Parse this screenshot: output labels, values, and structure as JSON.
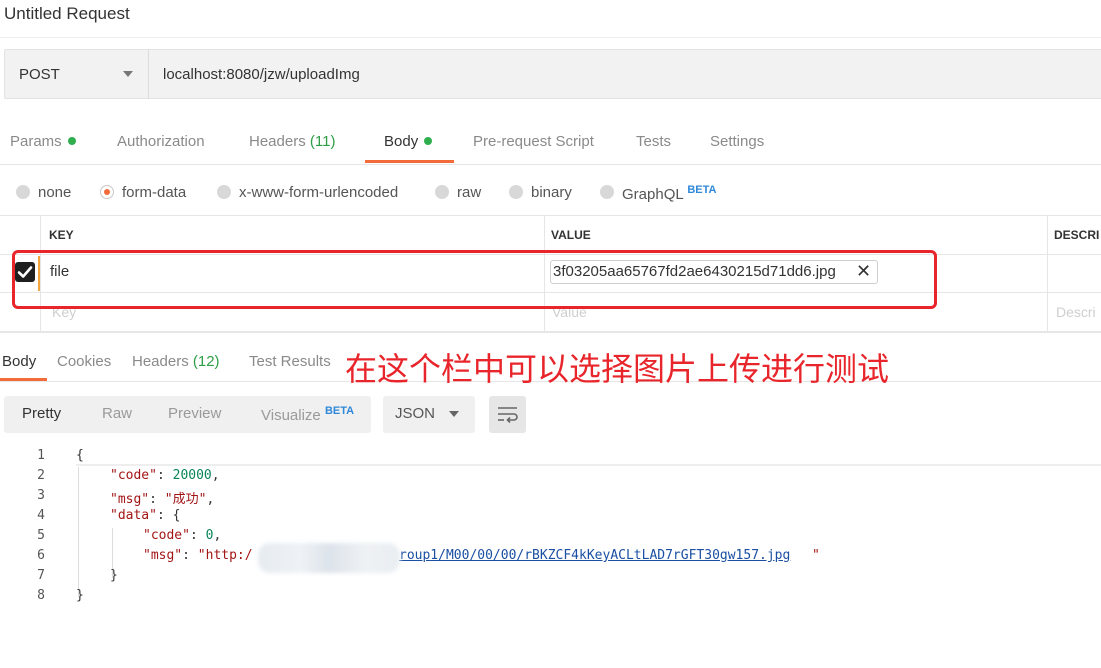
{
  "window": {
    "title": "Untitled Request"
  },
  "request": {
    "method": "POST",
    "url": "localhost:8080/jzw/uploadImg"
  },
  "request_tabs": [
    {
      "label": "Params",
      "indicator": "dot"
    },
    {
      "label": "Authorization"
    },
    {
      "label": "Headers",
      "count": "(11)"
    },
    {
      "label": "Body",
      "indicator": "dot",
      "active": true
    },
    {
      "label": "Pre-request Script"
    },
    {
      "label": "Tests"
    },
    {
      "label": "Settings"
    }
  ],
  "body_types": [
    {
      "label": "none",
      "selected": false
    },
    {
      "label": "form-data",
      "selected": true
    },
    {
      "label": "x-www-form-urlencoded",
      "selected": false
    },
    {
      "label": "raw",
      "selected": false
    },
    {
      "label": "binary",
      "selected": false
    },
    {
      "label": "GraphQL",
      "badge": "BETA",
      "selected": false
    }
  ],
  "form_table": {
    "headers": [
      "KEY",
      "VALUE",
      "DESCRI"
    ],
    "rows": [
      {
        "checked": true,
        "key": "file",
        "value": "3f03205aa65767fd2ae6430215d71dd6.jpg"
      }
    ],
    "placeholders": {
      "key": "Key",
      "value": "Value",
      "description": "Descri"
    }
  },
  "response_tabs": [
    {
      "label": "Body",
      "active": true
    },
    {
      "label": "Cookies"
    },
    {
      "label": "Headers",
      "count": "(12)"
    },
    {
      "label": "Test Results"
    }
  ],
  "annotation": "在这个栏中可以选择图片上传进行测试",
  "format_toolbar": {
    "modes": [
      "Pretty",
      "Raw",
      "Preview",
      "Visualize"
    ],
    "visualize_badge": "BETA",
    "language": "JSON"
  },
  "response_code": {
    "line_numbers": [
      "1",
      "2",
      "3",
      "4",
      "5",
      "6",
      "7",
      "8"
    ],
    "lines": {
      "l1": "{",
      "l2_key": "\"code\"",
      "l2_val": "20000",
      "l3_key": "\"msg\"",
      "l3_val": "\"成功\"",
      "l4_key": "\"data\"",
      "l4_open": "{",
      "l5_key": "\"code\"",
      "l5_val": "0",
      "l6_key": "\"msg\"",
      "l6_val_start": "\"http:/",
      "l6_val_end": "roup1/M00/00/00/rBKZCF4kKeyACLtLAD7rGFT30gw157.jpg",
      "l6_quote": "\"",
      "l7": "}",
      "l8": "}"
    }
  },
  "colors": {
    "accent": "#f26b3a",
    "active_dot": "#2fae4e",
    "annotation_red": "#e8252b",
    "beta_blue": "#2f88d8"
  }
}
